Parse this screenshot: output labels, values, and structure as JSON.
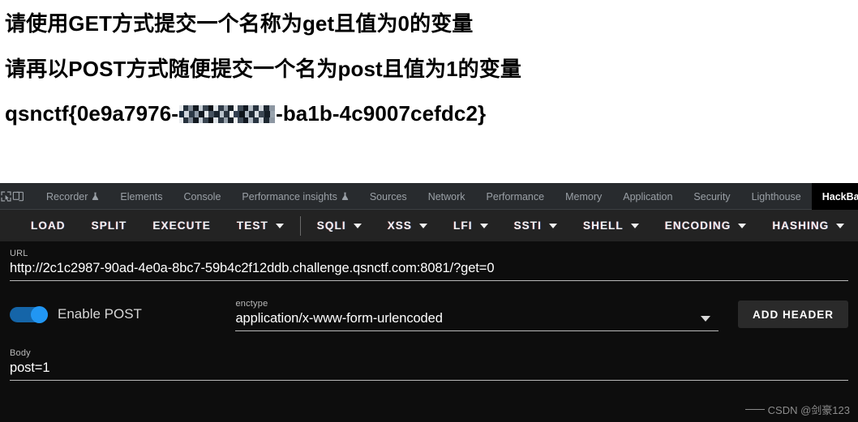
{
  "page_output": {
    "line1": "请使用GET方式提交一个名称为get且值为0的变量",
    "line2": "请再以POST方式随便提交一个名为post且值为1的变量",
    "flag_prefix": "qsnctf{0e9a7976-",
    "flag_redacted": "",
    "flag_suffix": "-ba1b-4c9007cefdc2}"
  },
  "devtools": {
    "icons": [
      {
        "name": "inspect-element-icon"
      },
      {
        "name": "device-toolbar-icon"
      }
    ],
    "tabs": [
      {
        "label": "Recorder",
        "icon": "flask-icon",
        "active": false
      },
      {
        "label": "Elements",
        "icon": "",
        "active": false
      },
      {
        "label": "Console",
        "icon": "",
        "active": false
      },
      {
        "label": "Performance insights",
        "icon": "flask-icon",
        "active": false
      },
      {
        "label": "Sources",
        "icon": "",
        "active": false
      },
      {
        "label": "Network",
        "icon": "",
        "active": false
      },
      {
        "label": "Performance",
        "icon": "",
        "active": false
      },
      {
        "label": "Memory",
        "icon": "",
        "active": false
      },
      {
        "label": "Application",
        "icon": "",
        "active": false
      },
      {
        "label": "Security",
        "icon": "",
        "active": false
      },
      {
        "label": "Lighthouse",
        "icon": "",
        "active": false
      },
      {
        "label": "HackBar",
        "icon": "",
        "active": true
      }
    ]
  },
  "hackbar": {
    "toolbar": [
      {
        "label": "LOAD",
        "caret": false
      },
      {
        "label": "SPLIT",
        "caret": false
      },
      {
        "label": "EXECUTE",
        "caret": false
      },
      {
        "label": "TEST",
        "caret": true
      },
      {
        "label": "SQLI",
        "caret": true
      },
      {
        "label": "XSS",
        "caret": true
      },
      {
        "label": "LFI",
        "caret": true
      },
      {
        "label": "SSTI",
        "caret": true
      },
      {
        "label": "SHELL",
        "caret": true
      },
      {
        "label": "ENCODING",
        "caret": true
      },
      {
        "label": "HASHING",
        "caret": true
      }
    ],
    "url": {
      "label": "URL",
      "value": "http://2c1c2987-90ad-4e0a-8bc7-59b4c2f12ddb.challenge.qsnctf.com:8081/?get=0"
    },
    "enable_post": {
      "label": "Enable POST",
      "checked": true
    },
    "enctype": {
      "label": "enctype",
      "value": "application/x-www-form-urlencoded"
    },
    "add_header_button": "ADD HEADER",
    "body": {
      "label": "Body",
      "value": "post=1"
    }
  },
  "watermark": {
    "text": "CSDN @剑豪123"
  },
  "colors": {
    "accent_toggle": "#2196f3",
    "tabbar_bg": "#282b2e",
    "toolbar_bg": "#232323",
    "panel_bg": "#0d0d0d",
    "active_tab_bg": "#000000"
  }
}
